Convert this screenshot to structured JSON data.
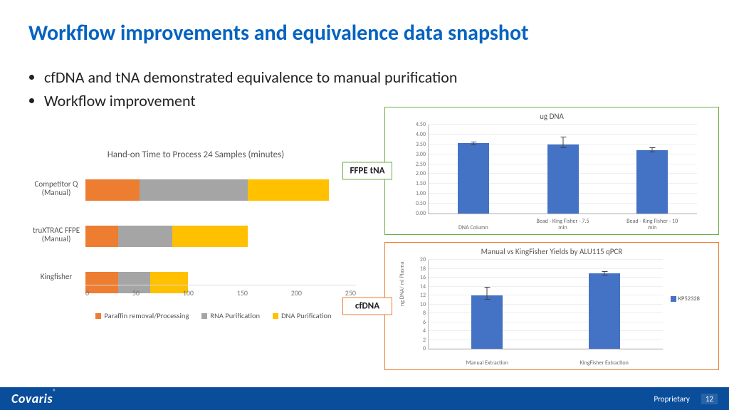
{
  "title": "Workflow improvements and equivalence data snapshot",
  "bullets": [
    "cfDNA and tNA demonstrated equivalence to manual purification",
    "Workflow improvement"
  ],
  "footer": {
    "brand": "Covaris",
    "reg": "®",
    "tag": "Proprietary",
    "page": "12"
  },
  "chart_data": [
    {
      "type": "bar",
      "orientation": "horizontal",
      "stacked": true,
      "title": "Hand-on Time to Process 24 Samples (minutes)",
      "xlabel": "",
      "ylabel": "",
      "xlim": [
        0,
        250
      ],
      "xticks": [
        0,
        50,
        100,
        150,
        200,
        250
      ],
      "categories": [
        "Competitor Q (Manual)",
        "truXTRAC FFPE (Manual)",
        "Kingfisher"
      ],
      "series": [
        {
          "name": "Paraffin removal/Processing",
          "color": "#ED7D31",
          "values": [
            50,
            30,
            30
          ]
        },
        {
          "name": "RNA Purification",
          "color": "#A5A5A5",
          "values": [
            100,
            50,
            30
          ]
        },
        {
          "name": "DNA Purification",
          "color": "#FFC000",
          "values": [
            75,
            70,
            35
          ]
        }
      ]
    },
    {
      "type": "bar",
      "panel_label": "FFPE tNA",
      "title": "ug DNA",
      "xlabel": "",
      "ylabel": "",
      "ylim": [
        0,
        4.5
      ],
      "yticks": [
        0.0,
        0.5,
        1.0,
        1.5,
        2.0,
        2.5,
        3.0,
        3.5,
        4.0,
        4.5
      ],
      "categories": [
        "DNA Column",
        "Bead - King Fisher - 7.5 min",
        "Bead - King Fisher - 10 min"
      ],
      "series": [
        {
          "name": "ug DNA",
          "color": "#4472C4",
          "values": [
            3.55,
            3.5,
            3.2
          ],
          "error_low": [
            0.1,
            0.2,
            0.1
          ],
          "error_high": [
            0.1,
            0.4,
            0.15
          ]
        }
      ]
    },
    {
      "type": "bar",
      "panel_label": "cfDNA",
      "title": "Manual vs KingFisher Yields by ALU115 qPCR",
      "xlabel": "",
      "ylabel": "ng DNA/ ml Plasma",
      "ylim": [
        0,
        20
      ],
      "yticks": [
        0,
        2,
        4,
        6,
        8,
        10,
        12,
        14,
        16,
        18,
        20
      ],
      "categories": [
        "Manual Extraction",
        "KingFisher Extraction"
      ],
      "series": [
        {
          "name": "KP52328",
          "color": "#4472C4",
          "values": [
            12,
            17
          ],
          "error_low": [
            1.0,
            0.5
          ],
          "error_high": [
            2.0,
            0.5
          ]
        }
      ],
      "legend_position": "right"
    }
  ]
}
